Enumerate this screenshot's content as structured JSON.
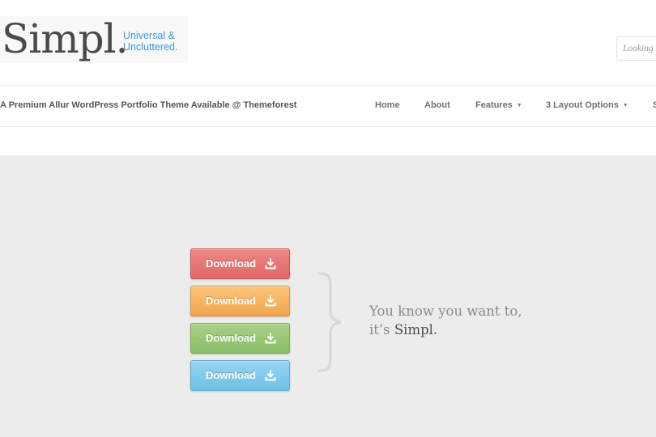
{
  "header": {
    "logo": "Simpl.",
    "tagline_line1": "Universal &",
    "tagline_line2": "Uncluttered.",
    "search_placeholder": "Looking"
  },
  "nav": {
    "subtitle": "A Premium Allur WordPress Portfolio Theme Available @ Themeforest",
    "items": [
      {
        "label": "Home"
      },
      {
        "label": "About"
      },
      {
        "label": "Features",
        "caret": "▼"
      },
      {
        "label": "3 Layout Options",
        "caret": "▼"
      },
      {
        "label": "S"
      }
    ]
  },
  "banner": {
    "buttons": [
      {
        "label": "Download",
        "color": "#e57373"
      },
      {
        "label": "Download",
        "color": "#f7b461"
      },
      {
        "label": "Download",
        "color": "#9ac878"
      },
      {
        "label": "Download",
        "color": "#82cbeb"
      }
    ],
    "pitch_line1": "You know you want to,",
    "pitch_line2_prefix": "it’s ",
    "pitch_brand": "Simpl."
  },
  "colors": {
    "accent": "#3d9ad6",
    "banner_bg": "#ececec",
    "logo_text": "#4a4a4a"
  },
  "icons": {
    "download": "download-tray-icon",
    "brace": "curly-brace-icon"
  }
}
